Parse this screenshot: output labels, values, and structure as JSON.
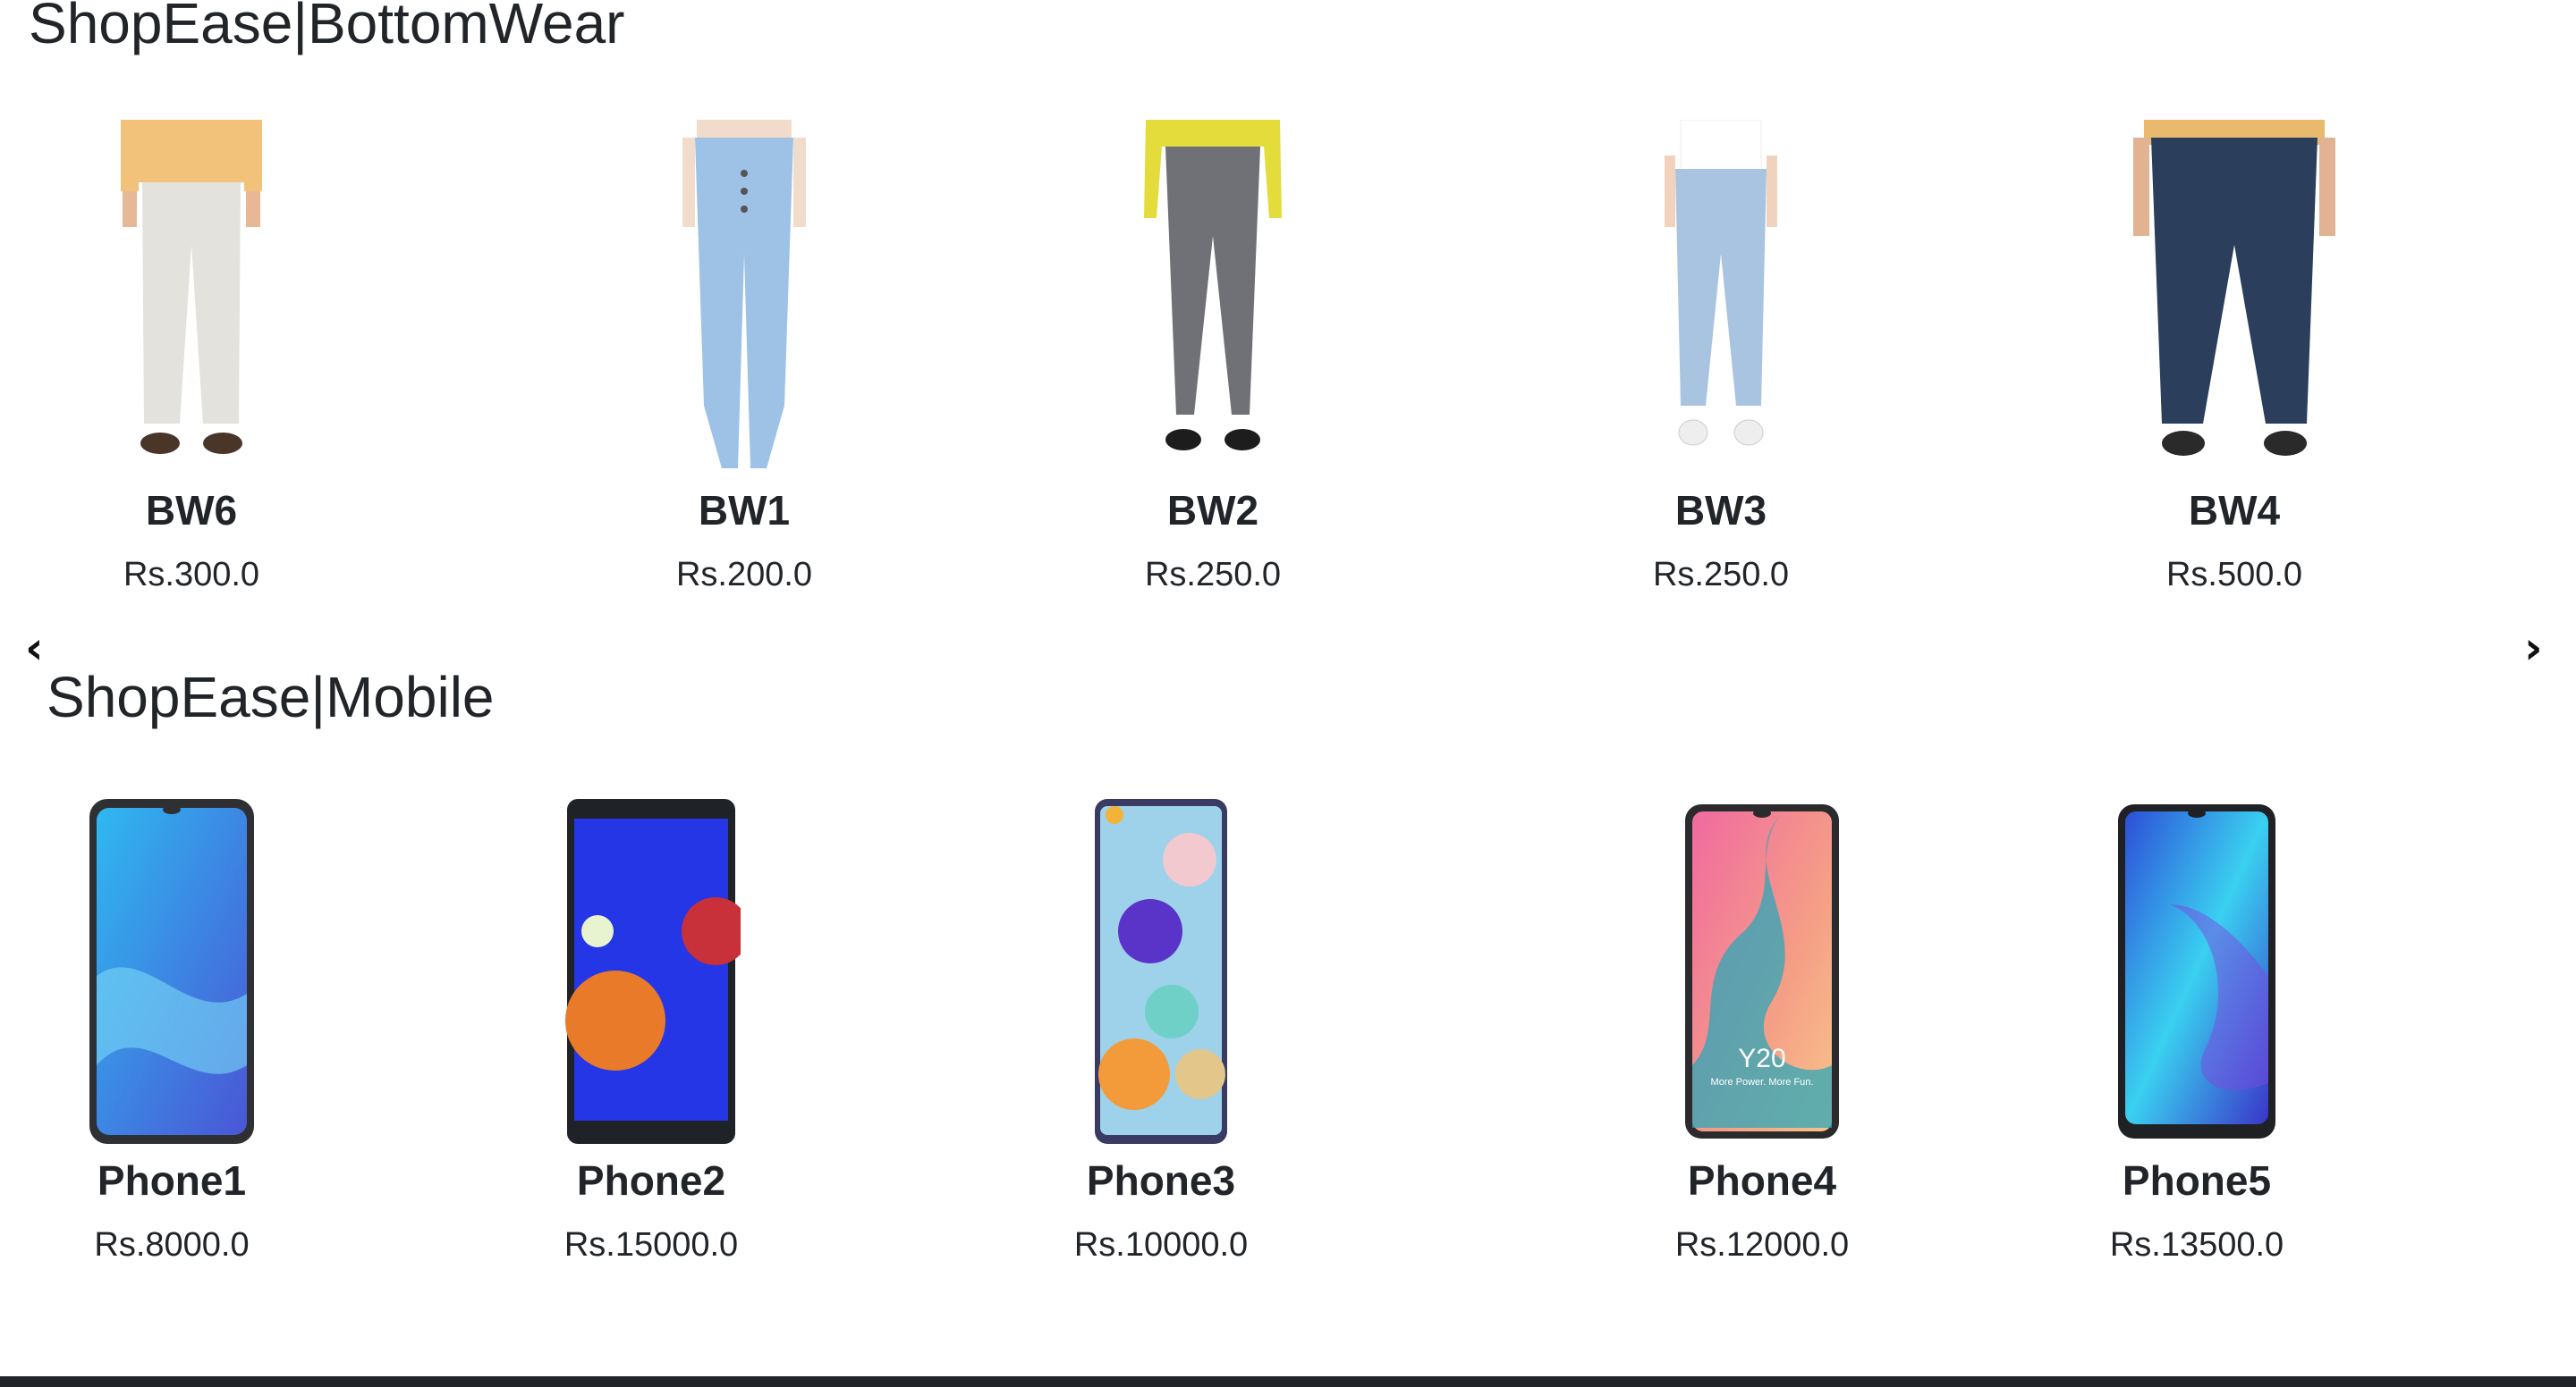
{
  "sections": {
    "bottomwear": {
      "title": "ShopEase|BottomWear",
      "products": [
        {
          "name": "BW6",
          "price": "Rs.300.0",
          "image": "pants-beige-image",
          "top_color": "#f2c27a",
          "pants_color": "#e4e2dd",
          "shoe_color": "#4a3529"
        },
        {
          "name": "BW1",
          "price": "Rs.200.0",
          "image": "jeans-light-blue-image",
          "top_color": "#f1dccb",
          "pants_color": "#9dc2e6",
          "shoe_color": "#d9c9b8"
        },
        {
          "name": "BW2",
          "price": "Rs.250.0",
          "image": "jeggings-grey-image",
          "top_color": "#e3dc3a",
          "pants_color": "#6f7176",
          "shoe_color": "#1d1d1d"
        },
        {
          "name": "BW3",
          "price": "Rs.250.0",
          "image": "jeans-mom-fit-image",
          "top_color": "#ffffff",
          "pants_color": "#a9c4e0",
          "shoe_color": "#eeeeee"
        },
        {
          "name": "BW4",
          "price": "Rs.500.0",
          "image": "jeans-dark-blue-image",
          "top_color": "#e9b96e",
          "pants_color": "#2b3e5c",
          "shoe_color": "#2a2a2a"
        }
      ]
    },
    "mobile": {
      "title": "ShopEase|Mobile",
      "products": [
        {
          "name": "Phone1",
          "price": "Rs.8000.0",
          "image": "phone-redmi-image",
          "frame_color": "#2f3033",
          "screen_a": "#2fb8f0",
          "screen_b": "#4a56d6"
        },
        {
          "name": "Phone2",
          "price": "Rs.15000.0",
          "image": "phone-galaxy-a01-image",
          "frame_color": "#1f2328",
          "screen_a": "#2536e6",
          "screen_b": "#e87a2a"
        },
        {
          "name": "Phone3",
          "price": "Rs.10000.0",
          "image": "phone-galaxy-a21-image",
          "frame_color": "#3a3b63",
          "screen_a": "#9dd2ea",
          "screen_b": "#5a33c9"
        },
        {
          "name": "Phone4",
          "price": "Rs.12000.0",
          "image": "phone-vivo-y20-image",
          "frame_color": "#2b2b2e",
          "screen_a": "#f59e86",
          "screen_b": "#2ea7b8"
        },
        {
          "name": "Phone5",
          "price": "Rs.13500.0",
          "image": "phone-vivo-blue-image",
          "frame_color": "#1f2124",
          "screen_a": "#3ad0f0",
          "screen_b": "#3b34c8"
        }
      ]
    }
  },
  "phone4_screen_text": "Y20",
  "phone4_screen_tagline": "More Power. More Fun.",
  "carousel": {
    "prev_icon": "chevron-left-icon",
    "next_icon": "chevron-right-icon",
    "prev_glyph": "‹",
    "next_glyph": "›"
  }
}
